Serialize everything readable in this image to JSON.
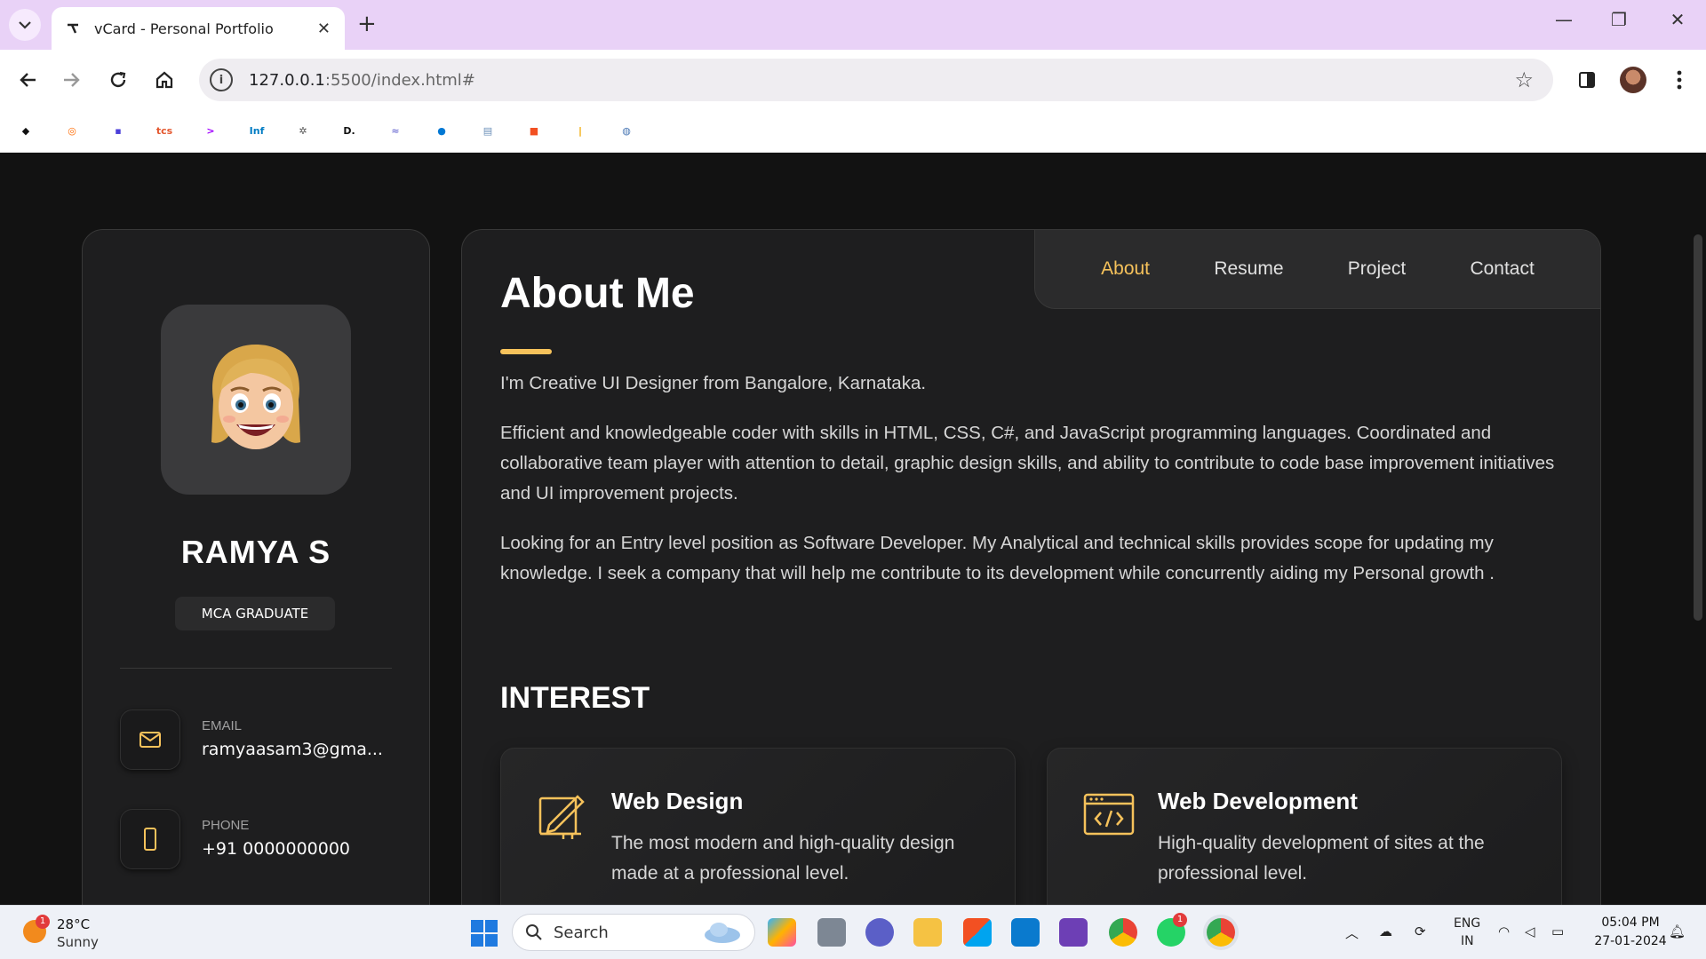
{
  "browser": {
    "tab_title": "vCard - Personal Portfolio",
    "url_host": "127.0.0.1",
    "url_path": ":5500/index.html#",
    "bookmarks": [
      {
        "name": "bookmark-generic-icon",
        "color": "#111111",
        "glyph": "◆"
      },
      {
        "name": "bookmark-ring-icon",
        "color": "#ff6a00",
        "glyph": "◎"
      },
      {
        "name": "bookmark-purple-icon",
        "color": "#4b3fd9",
        "glyph": "▪"
      },
      {
        "name": "bookmark-tcs-icon",
        "color": "#e4572e",
        "glyph": "tcs"
      },
      {
        "name": "bookmark-accenture-icon",
        "color": "#a100ff",
        "glyph": ">"
      },
      {
        "name": "bookmark-infosys-icon",
        "color": "#007cc3",
        "glyph": "Inf"
      },
      {
        "name": "bookmark-robot-icon",
        "color": "#555555",
        "glyph": "✲"
      },
      {
        "name": "bookmark-d-icon",
        "color": "#111111",
        "glyph": "D."
      },
      {
        "name": "bookmark-wave-icon",
        "color": "#7b7bd6",
        "glyph": "≈"
      },
      {
        "name": "bookmark-edge-icon",
        "color": "#0078d4",
        "glyph": "●"
      },
      {
        "name": "bookmark-doc-icon",
        "color": "#6b8fb8",
        "glyph": "▤"
      },
      {
        "name": "bookmark-microsoft-icon",
        "color": "#f25022",
        "glyph": "■"
      },
      {
        "name": "bookmark-bars-icon",
        "color": "#f2a900",
        "glyph": "|"
      },
      {
        "name": "bookmark-logo-icon",
        "color": "#4a78b5",
        "glyph": "◍"
      }
    ]
  },
  "sidebar": {
    "name": "RAMYA S",
    "title": "MCA GRADUATE",
    "contacts": [
      {
        "label": "EMAIL",
        "value": "ramyaasam3@gma...",
        "icon": "mail-icon"
      },
      {
        "label": "PHONE",
        "value": "+91 0000000000",
        "icon": "phone-icon"
      }
    ]
  },
  "nav": {
    "items": [
      "About",
      "Resume",
      "Project",
      "Contact"
    ],
    "active": "About"
  },
  "about": {
    "title": "About Me",
    "paragraphs": [
      "I'm Creative UI Designer from Bangalore, Karnataka.",
      "Efficient and knowledgeable coder with skills in HTML, CSS, C#, and JavaScript programming languages. Coordinated and collaborative team player with attention to detail, graphic design skills, and ability to contribute to code base improvement initiatives and UI improvement projects.",
      "Looking for an Entry level position as Software Developer. My Analytical and technical skills provides scope for updating my knowledge. I seek a company that will help me contribute to its development while concurrently aiding my Personal growth ."
    ]
  },
  "interest": {
    "title": "INTEREST",
    "cards": [
      {
        "title": "Web Design",
        "text": "The most modern and high-quality design made at a professional level.",
        "icon": "design-icon"
      },
      {
        "title": "Web Development",
        "text": "High-quality development of sites at the professional level.",
        "icon": "code-window-icon"
      }
    ]
  },
  "colors": {
    "accent": "#f6c25b",
    "page_bg": "#121212",
    "panel_bg": "#1e1e1f"
  },
  "taskbar": {
    "weather_temp": "28°C",
    "weather_desc": "Sunny",
    "weather_badge": "1",
    "search_label": "Search",
    "lang_1": "ENG",
    "lang_2": "IN",
    "time": "05:04 PM",
    "date": "27-01-2024",
    "whatsapp_badge": "1"
  }
}
